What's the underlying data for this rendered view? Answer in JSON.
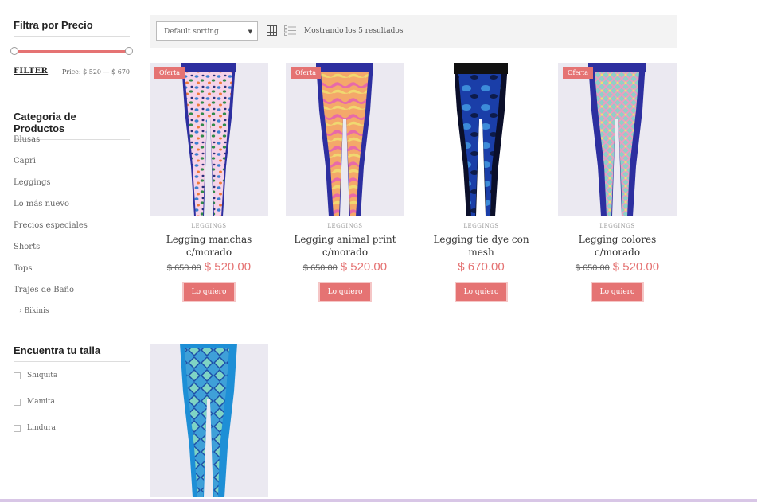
{
  "sidebar": {
    "price_filter": {
      "title": "Filtra por Precio",
      "filter_label": "FILTER",
      "price_label": "Price: $ 520 — $ 670"
    },
    "categories": {
      "title": "Categoria de Productos",
      "items": [
        {
          "label": "Blusas",
          "sub": false
        },
        {
          "label": "Capri",
          "sub": false
        },
        {
          "label": "Leggings",
          "sub": false
        },
        {
          "label": "Lo más nuevo",
          "sub": false
        },
        {
          "label": "Precios especiales",
          "sub": false
        },
        {
          "label": "Shorts",
          "sub": false
        },
        {
          "label": "Tops",
          "sub": false
        },
        {
          "label": "Trajes de Baño",
          "sub": false
        },
        {
          "label": "› Bikinis",
          "sub": true
        }
      ]
    },
    "sizes": {
      "title": "Encuentra tu talla",
      "items": [
        {
          "label": "Shiquita"
        },
        {
          "label": "Mamita"
        },
        {
          "label": "Lindura"
        }
      ]
    }
  },
  "toolbar": {
    "sort_value": "Default sorting",
    "result_count": "Mostrando los 5 resultados"
  },
  "products": [
    {
      "badge": "Oferta",
      "category": "LEGGINGS",
      "name": "Legging manchas c/morado",
      "old_price": "$ 650.00",
      "price": "$ 520.00",
      "button": "Lo quiero",
      "image": "leopard-print-leggings"
    },
    {
      "badge": "Oferta",
      "category": "LEGGINGS",
      "name": "Legging animal print c/morado",
      "old_price": "$ 650.00",
      "price": "$ 520.00",
      "button": "Lo quiero",
      "image": "animal-print-leggings"
    },
    {
      "badge": "",
      "category": "LEGGINGS",
      "name": "Legging tie dye con mesh",
      "old_price": "",
      "price": "$ 670.00",
      "button": "Lo quiero",
      "image": "tie-dye-leggings"
    },
    {
      "badge": "Oferta",
      "category": "LEGGINGS",
      "name": "Legging colores c/morado",
      "old_price": "$ 650.00",
      "price": "$ 520.00",
      "button": "Lo quiero",
      "image": "colorful-leggings"
    },
    {
      "badge": "",
      "category": "",
      "name": "",
      "old_price": "",
      "price": "",
      "button": "",
      "image": "snake-print-leggings"
    }
  ],
  "colors": {
    "accent": "#e57373",
    "legging_band": "#2d2fa0"
  }
}
